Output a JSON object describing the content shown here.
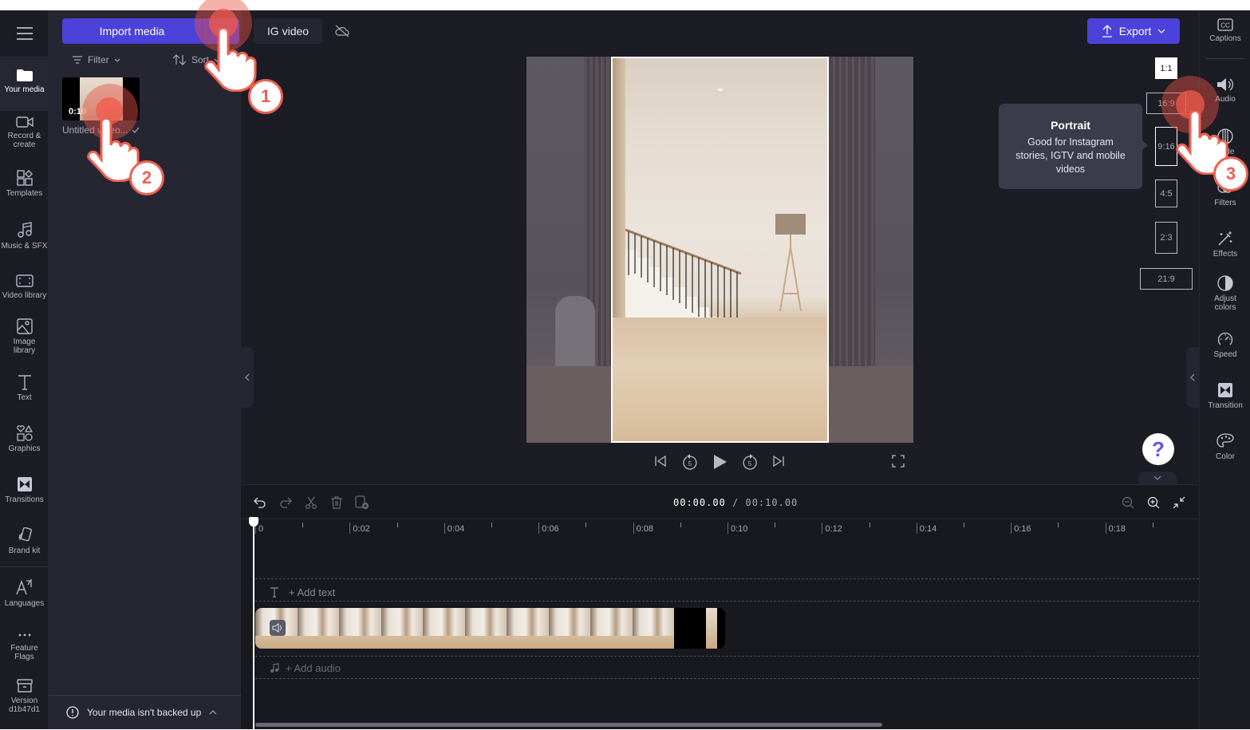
{
  "left_nav": {
    "menu_icon": "hamburger-icon",
    "items": [
      {
        "label": "Your media",
        "icon": "folder-icon",
        "active": true
      },
      {
        "label": "Record &\ncreate",
        "icon": "camera-icon"
      },
      {
        "label": "Templates",
        "icon": "templates-icon"
      },
      {
        "label": "Music & SFX",
        "icon": "music-icon"
      },
      {
        "label": "Video library",
        "icon": "film-icon"
      },
      {
        "label": "Image\nlibrary",
        "icon": "image-icon"
      },
      {
        "label": "Text",
        "icon": "text-icon"
      },
      {
        "label": "Graphics",
        "icon": "shapes-icon"
      },
      {
        "label": "Transitions",
        "icon": "transitions-icon"
      },
      {
        "label": "Brand kit",
        "icon": "brand-kit-icon"
      },
      {
        "label": "Languages",
        "icon": "languages-icon"
      },
      {
        "label": "Feature\nFlags",
        "icon": "more-icon"
      },
      {
        "label": "Version\nd1b47d1",
        "icon": "archive-icon"
      }
    ]
  },
  "media_panel": {
    "import_label": "Import media",
    "filter_label": "Filter",
    "sort_label": "Sort",
    "items": [
      {
        "duration": "0:10",
        "name": "Untitled video..."
      }
    ],
    "backup_status": "Your media isn't backed up"
  },
  "top_bar": {
    "project_title": "IG video",
    "export_label": "Export"
  },
  "aspect_ratios": {
    "options": [
      "1:1",
      "16:9",
      "9:16",
      "4:5",
      "2:3",
      "21:9"
    ],
    "selected": "1:1",
    "tooltip": {
      "title": "Portrait",
      "body": "Good for Instagram stories, IGTV and mobile videos"
    }
  },
  "right_nav": {
    "items": [
      {
        "label": "Captions",
        "icon": "captions-icon"
      },
      {
        "label": "Audio",
        "icon": "audio-icon"
      },
      {
        "label": "Fade",
        "icon": "fade-icon"
      },
      {
        "label": "Filters",
        "icon": "filters-icon"
      },
      {
        "label": "Effects",
        "icon": "effects-icon"
      },
      {
        "label": "Adjust\ncolors",
        "icon": "adjust-colors-icon"
      },
      {
        "label": "Speed",
        "icon": "speed-icon"
      },
      {
        "label": "Transition",
        "icon": "transition-icon"
      },
      {
        "label": "Color",
        "icon": "color-palette-icon"
      }
    ]
  },
  "playback": {
    "controls": [
      "skip-to-start",
      "rewind-5",
      "play",
      "forward-5",
      "skip-to-end",
      "fullscreen"
    ]
  },
  "timeline": {
    "current_time": "00:00.00",
    "total_time": "/ 00:10.00",
    "ruler_labels": [
      "0",
      "0:02",
      "0:04",
      "0:06",
      "0:08",
      "0:10",
      "0:12",
      "0:14",
      "0:16",
      "0:18"
    ],
    "add_text_label": "+ Add text",
    "add_audio_label": "+ Add audio"
  },
  "tutorial": {
    "steps": [
      "1",
      "2",
      "3"
    ]
  },
  "help_label": "?",
  "colors": {
    "accent": "#4c41d8",
    "background": "#1c1c24",
    "panel": "#262633",
    "tutorial_red": "#ef5f50"
  }
}
